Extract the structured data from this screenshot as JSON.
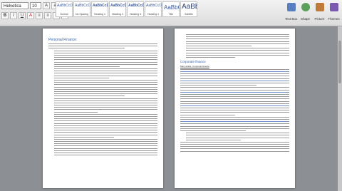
{
  "toolbar": {
    "font_name": "Helvetica",
    "font_size": "10",
    "buttons": [
      "B",
      "I",
      "U",
      "A"
    ],
    "align_buttons": [
      "≡",
      "≡",
      "≡",
      "≡"
    ]
  },
  "styles": [
    {
      "preview": "AaBbCcDdEe",
      "name": "Normal"
    },
    {
      "preview": "AaBbCcDdEe",
      "name": "No Spacing"
    },
    {
      "preview": "AaBbCcDd",
      "name": "Heading 1"
    },
    {
      "preview": "AaBbCcDd",
      "name": "Heading 2"
    },
    {
      "preview": "AaBbCcDd",
      "name": "Heading 3"
    },
    {
      "preview": "AaBbCcDdEe",
      "name": "Heading 4"
    },
    {
      "preview": "AaBbCcDc",
      "name": "Title"
    },
    {
      "preview": "AaBbC",
      "name": "Subtitle"
    }
  ],
  "tools": [
    {
      "label": "Text Box",
      "icon": "text-box-icon",
      "color": "#5a7fc0"
    },
    {
      "label": "Shape",
      "icon": "shape-icon",
      "color": "#5aa05a"
    },
    {
      "label": "Picture",
      "icon": "picture-icon",
      "color": "#c07a3a"
    },
    {
      "label": "Themes",
      "icon": "themes-icon",
      "color": "#7a5ab0"
    }
  ],
  "document": {
    "left_heading": "Personal Finance:",
    "right_subhead": "Corporate finance",
    "right_subhead2": "Main article: Corporate finance"
  },
  "colors": {
    "accent": "#2f5da8",
    "desk": "#8c8f93"
  }
}
